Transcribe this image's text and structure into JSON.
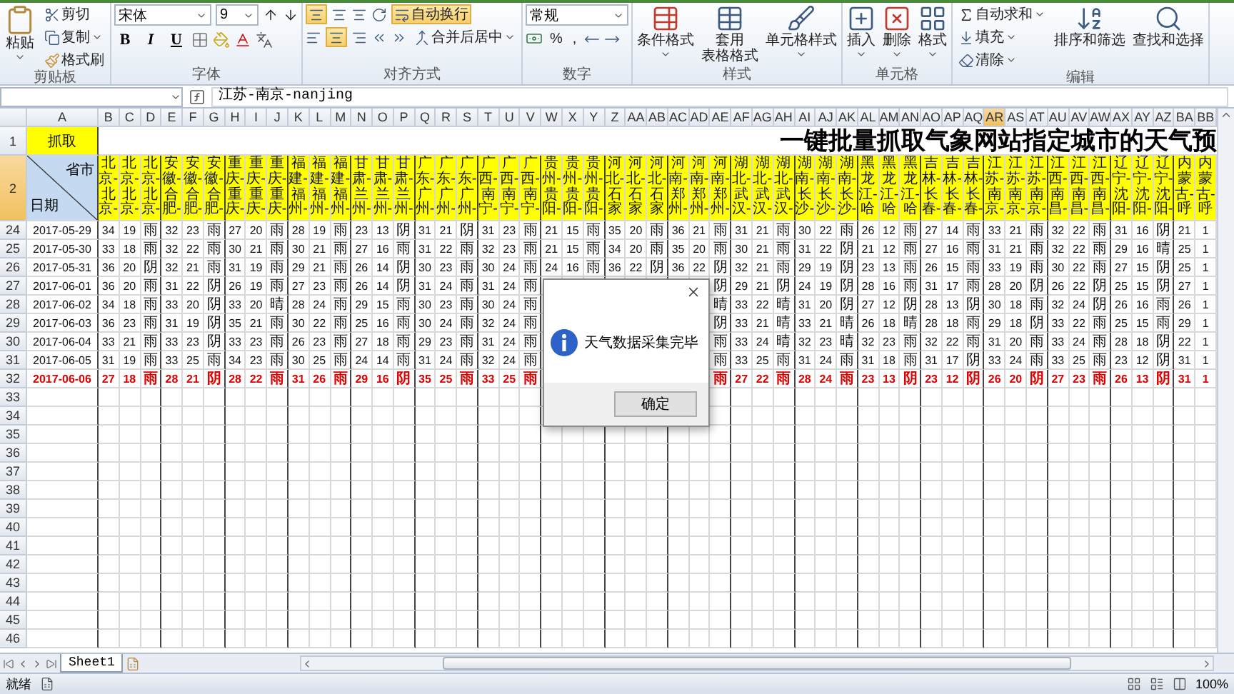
{
  "ribbon": {
    "clipboard": {
      "label": "剪贴板",
      "paste": "粘贴",
      "cut": "剪切",
      "copy": "复制",
      "format_painter": "格式刷"
    },
    "font": {
      "label": "字体",
      "font_name": "宋体",
      "font_size": "9",
      "bold": "B",
      "italic": "I",
      "underline": "U"
    },
    "alignment": {
      "label": "对齐方式",
      "top_align_on": true,
      "center_on": true,
      "wrap_text": "自动换行",
      "wrap_text_on": true,
      "merge_center": "合并后居中"
    },
    "number": {
      "label": "数字",
      "format": "常规",
      "percent": "%",
      "comma": ","
    },
    "styles": {
      "label": "样式",
      "conditional": "条件格式",
      "table_format_1": "套用",
      "table_format_2": "表格格式",
      "cell_styles": "单元格样式"
    },
    "cells": {
      "label": "单元格",
      "insert": "插入",
      "delete": "删除",
      "format": "格式"
    },
    "editing": {
      "label": "编辑",
      "autosum": "自动求和",
      "fill": "填充",
      "clear": "清除",
      "sort": "排序和筛选",
      "find": "查找和选择"
    }
  },
  "formula_bar": {
    "value": "江苏-南京-nanjing"
  },
  "columns": [
    {
      "label": "A",
      "selected": false
    },
    {
      "label": "B",
      "selected": false
    },
    {
      "label": "C",
      "selected": false
    },
    {
      "label": "D",
      "selected": false
    },
    {
      "label": "E",
      "selected": false
    },
    {
      "label": "F",
      "selected": false
    },
    {
      "label": "G",
      "selected": false
    },
    {
      "label": "H",
      "selected": false
    },
    {
      "label": "I",
      "selected": false
    },
    {
      "label": "J",
      "selected": false
    },
    {
      "label": "K",
      "selected": false
    },
    {
      "label": "L",
      "selected": false
    },
    {
      "label": "M",
      "selected": false
    },
    {
      "label": "N",
      "selected": false
    },
    {
      "label": "O",
      "selected": false
    },
    {
      "label": "P",
      "selected": false
    },
    {
      "label": "Q",
      "selected": false
    },
    {
      "label": "R",
      "selected": false
    },
    {
      "label": "S",
      "selected": false
    },
    {
      "label": "T",
      "selected": false
    },
    {
      "label": "U",
      "selected": false
    },
    {
      "label": "V",
      "selected": false
    },
    {
      "label": "W",
      "selected": false
    },
    {
      "label": "X",
      "selected": false
    },
    {
      "label": "Y",
      "selected": false
    },
    {
      "label": "Z",
      "selected": false
    },
    {
      "label": "AA",
      "selected": false
    },
    {
      "label": "AB",
      "selected": false
    },
    {
      "label": "AC",
      "selected": false
    },
    {
      "label": "AD",
      "selected": false
    },
    {
      "label": "AE",
      "selected": false
    },
    {
      "label": "AF",
      "selected": false
    },
    {
      "label": "AG",
      "selected": false
    },
    {
      "label": "AH",
      "selected": false
    },
    {
      "label": "AI",
      "selected": false
    },
    {
      "label": "AJ",
      "selected": false
    },
    {
      "label": "AK",
      "selected": false
    },
    {
      "label": "AL",
      "selected": false
    },
    {
      "label": "AM",
      "selected": false
    },
    {
      "label": "AN",
      "selected": false
    },
    {
      "label": "AO",
      "selected": false
    },
    {
      "label": "AP",
      "selected": false
    },
    {
      "label": "AQ",
      "selected": false
    },
    {
      "label": "AR",
      "selected": true
    },
    {
      "label": "AS",
      "selected": false
    },
    {
      "label": "AT",
      "selected": false
    },
    {
      "label": "AU",
      "selected": false
    },
    {
      "label": "AV",
      "selected": false
    },
    {
      "label": "AW",
      "selected": false
    },
    {
      "label": "AX",
      "selected": false
    },
    {
      "label": "AY",
      "selected": false
    },
    {
      "label": "AZ",
      "selected": false
    },
    {
      "label": "BA",
      "selected": false
    },
    {
      "label": "BB",
      "selected": false
    }
  ],
  "sheet": {
    "grab": "抓取",
    "title": "一键批量抓取气象网站指定城市的天气预",
    "corner_top": "省市",
    "corner_bottom": "日期",
    "header_rows": [
      {
        "label": "1",
        "selected": false
      },
      {
        "label": "2",
        "selected": true
      }
    ],
    "headers": [
      "北京-北京-",
      "北京-北京-",
      "北京-北京-",
      "安徽-合肥-",
      "安徽-合肥-",
      "安徽-合肥-",
      "重庆-重庆-",
      "重庆-重庆-",
      "重庆-重庆-",
      "福建-福州-",
      "福建-福州-",
      "福建-福州-",
      "甘肃-兰州-",
      "甘肃-兰州-",
      "甘肃-兰州-",
      "广东-广州-",
      "广东-广州-",
      "广东-广州-",
      "广西-南宁-",
      "广西-南宁-",
      "广西-南宁-",
      "贵州-贵阳-",
      "贵州-贵阳-",
      "贵州-贵阳-",
      "河北-石家",
      "河北-石家",
      "河北-石家",
      "河南-郑州-",
      "河南-郑州-",
      "河南-郑州-",
      "湖北-武汉-",
      "湖北-武汉-",
      "湖北-武汉-",
      "湖南-长沙-",
      "湖南-长沙-",
      "湖南-长沙-",
      "黑龙江-哈",
      "黑龙江-哈",
      "黑龙江-哈",
      "吉林-长春-",
      "吉林-长春-",
      "吉林-长春-",
      "江苏-南京-",
      "江苏-南京-",
      "江苏-南京-",
      "江西-南昌-",
      "江西-南昌-",
      "江西-南昌-",
      "辽宁-沈阳-",
      "辽宁-沈阳-",
      "辽宁-沈阳-",
      "内蒙古-呼",
      "内蒙古-呼"
    ],
    "rows": [
      {
        "num": "24",
        "date": "2017-05-29",
        "highlight": false,
        "cells": [
          "34",
          "19",
          "雨",
          "32",
          "23",
          "雨",
          "27",
          "20",
          "雨",
          "28",
          "19",
          "雨",
          "23",
          "13",
          "阴",
          "31",
          "21",
          "阴",
          "31",
          "23",
          "雨",
          "21",
          "15",
          "雨",
          "35",
          "20",
          "雨",
          "36",
          "21",
          "雨",
          "31",
          "21",
          "雨",
          "30",
          "22",
          "雨",
          "26",
          "12",
          "雨",
          "27",
          "14",
          "雨",
          "33",
          "21",
          "雨",
          "32",
          "22",
          "雨",
          "31",
          "16",
          "阴",
          "21",
          "1"
        ]
      },
      {
        "num": "25",
        "date": "2017-05-30",
        "highlight": false,
        "cells": [
          "33",
          "18",
          "雨",
          "32",
          "22",
          "雨",
          "30",
          "21",
          "雨",
          "30",
          "21",
          "雨",
          "27",
          "16",
          "雨",
          "31",
          "22",
          "雨",
          "32",
          "23",
          "雨",
          "21",
          "15",
          "雨",
          "34",
          "20",
          "雨",
          "35",
          "20",
          "雨",
          "30",
          "21",
          "雨",
          "31",
          "22",
          "阴",
          "21",
          "12",
          "雨",
          "27",
          "16",
          "雨",
          "31",
          "21",
          "雨",
          "32",
          "22",
          "雨",
          "29",
          "16",
          "晴",
          "25",
          "1"
        ]
      },
      {
        "num": "26",
        "date": "2017-05-31",
        "highlight": false,
        "cells": [
          "36",
          "20",
          "阴",
          "32",
          "21",
          "雨",
          "31",
          "19",
          "雨",
          "29",
          "21",
          "雨",
          "26",
          "14",
          "阴",
          "30",
          "23",
          "雨",
          "30",
          "24",
          "雨",
          "24",
          "16",
          "雨",
          "36",
          "22",
          "阴",
          "36",
          "22",
          "阴",
          "32",
          "21",
          "雨",
          "29",
          "19",
          "阴",
          "23",
          "13",
          "雨",
          "26",
          "15",
          "雨",
          "33",
          "19",
          "雨",
          "30",
          "22",
          "雨",
          "27",
          "15",
          "阴",
          "25",
          "1"
        ]
      },
      {
        "num": "27",
        "date": "2017-06-01",
        "highlight": false,
        "cells": [
          "36",
          "20",
          "雨",
          "31",
          "22",
          "阴",
          "26",
          "19",
          "雨",
          "27",
          "23",
          "雨",
          "26",
          "14",
          "阴",
          "31",
          "24",
          "雨",
          "31",
          "24",
          "雨",
          null,
          null,
          null,
          null,
          null,
          null,
          null,
          null,
          "阴",
          "29",
          "21",
          "阴",
          "24",
          "19",
          "阴",
          "28",
          "16",
          "雨",
          "31",
          "17",
          "雨",
          "28",
          "20",
          "阴",
          "26",
          "22",
          "阴",
          "25",
          "15",
          "阴",
          "27",
          "1"
        ]
      },
      {
        "num": "28",
        "date": "2017-06-02",
        "highlight": false,
        "cells": [
          "34",
          "18",
          "雨",
          "33",
          "20",
          "阴",
          "33",
          "20",
          "晴",
          "28",
          "24",
          "雨",
          "29",
          "15",
          "雨",
          "30",
          "23",
          "雨",
          "30",
          "24",
          "雨",
          null,
          null,
          null,
          null,
          null,
          null,
          null,
          null,
          "晴",
          "33",
          "22",
          "晴",
          "31",
          "20",
          "阴",
          "27",
          "12",
          "阴",
          "28",
          "13",
          "阴",
          "30",
          "18",
          "雨",
          "32",
          "24",
          "阴",
          "26",
          "16",
          "雨",
          "26",
          "1"
        ]
      },
      {
        "num": "29",
        "date": "2017-06-03",
        "highlight": false,
        "cells": [
          "36",
          "23",
          "雨",
          "31",
          "19",
          "阴",
          "35",
          "21",
          "雨",
          "30",
          "22",
          "雨",
          "25",
          "16",
          "雨",
          "30",
          "24",
          "雨",
          "32",
          "24",
          "雨",
          null,
          null,
          null,
          null,
          null,
          null,
          null,
          null,
          "阴",
          "33",
          "21",
          "晴",
          "33",
          "21",
          "晴",
          "26",
          "18",
          "晴",
          "28",
          "18",
          "雨",
          "29",
          "18",
          "阴",
          "33",
          "22",
          "雨",
          "25",
          "15",
          "雨",
          "29",
          "1"
        ]
      },
      {
        "num": "30",
        "date": "2017-06-04",
        "highlight": false,
        "cells": [
          "33",
          "21",
          "雨",
          "33",
          "23",
          "阴",
          "33",
          "23",
          "雨",
          "26",
          "23",
          "雨",
          "27",
          "18",
          "雨",
          "29",
          "23",
          "雨",
          "31",
          "24",
          "雨",
          null,
          null,
          null,
          null,
          null,
          null,
          null,
          null,
          "雨",
          "33",
          "24",
          "晴",
          "32",
          "23",
          "晴",
          "32",
          "23",
          "雨",
          "32",
          "22",
          "雨",
          "31",
          "20",
          "雨",
          "33",
          "24",
          "雨",
          "28",
          "18",
          "阴",
          "22",
          "1"
        ]
      },
      {
        "num": "31",
        "date": "2017-06-05",
        "highlight": false,
        "cells": [
          "31",
          "19",
          "雨",
          "33",
          "25",
          "雨",
          "34",
          "23",
          "雨",
          "30",
          "25",
          "雨",
          "24",
          "14",
          "雨",
          "31",
          "24",
          "雨",
          "32",
          "24",
          "雨",
          null,
          null,
          null,
          null,
          null,
          null,
          null,
          null,
          "雨",
          "33",
          "25",
          "雨",
          "31",
          "24",
          "雨",
          "31",
          "18",
          "雨",
          "31",
          "17",
          "阴",
          "33",
          "24",
          "雨",
          "33",
          "25",
          "雨",
          "23",
          "12",
          "阴",
          "31",
          "1"
        ]
      },
      {
        "num": "32",
        "date": "2017-06-06",
        "highlight": true,
        "cells": [
          "27",
          "18",
          "雨",
          "28",
          "21",
          "阴",
          "28",
          "22",
          "雨",
          "31",
          "26",
          "雨",
          "29",
          "16",
          "阴",
          "35",
          "25",
          "雨",
          "33",
          "25",
          "雨",
          null,
          null,
          null,
          null,
          null,
          null,
          null,
          null,
          "雨",
          "27",
          "22",
          "雨",
          "28",
          "24",
          "雨",
          "23",
          "13",
          "阴",
          "23",
          "12",
          "阴",
          "26",
          "20",
          "阴",
          "27",
          "23",
          "雨",
          "26",
          "13",
          "阴",
          "31",
          "1"
        ]
      }
    ],
    "empty_rows": [
      "33",
      "34",
      "35",
      "36",
      "37",
      "38",
      "39",
      "40",
      "41",
      "42",
      "43",
      "44",
      "45",
      "46"
    ]
  },
  "dialog": {
    "message": "天气数据采集完毕",
    "ok": "确定"
  },
  "sheet_tabs": [
    {
      "label": "Sheet1",
      "selected": true
    }
  ],
  "status_bar": {
    "text": "就绪",
    "zoom": "100%"
  }
}
